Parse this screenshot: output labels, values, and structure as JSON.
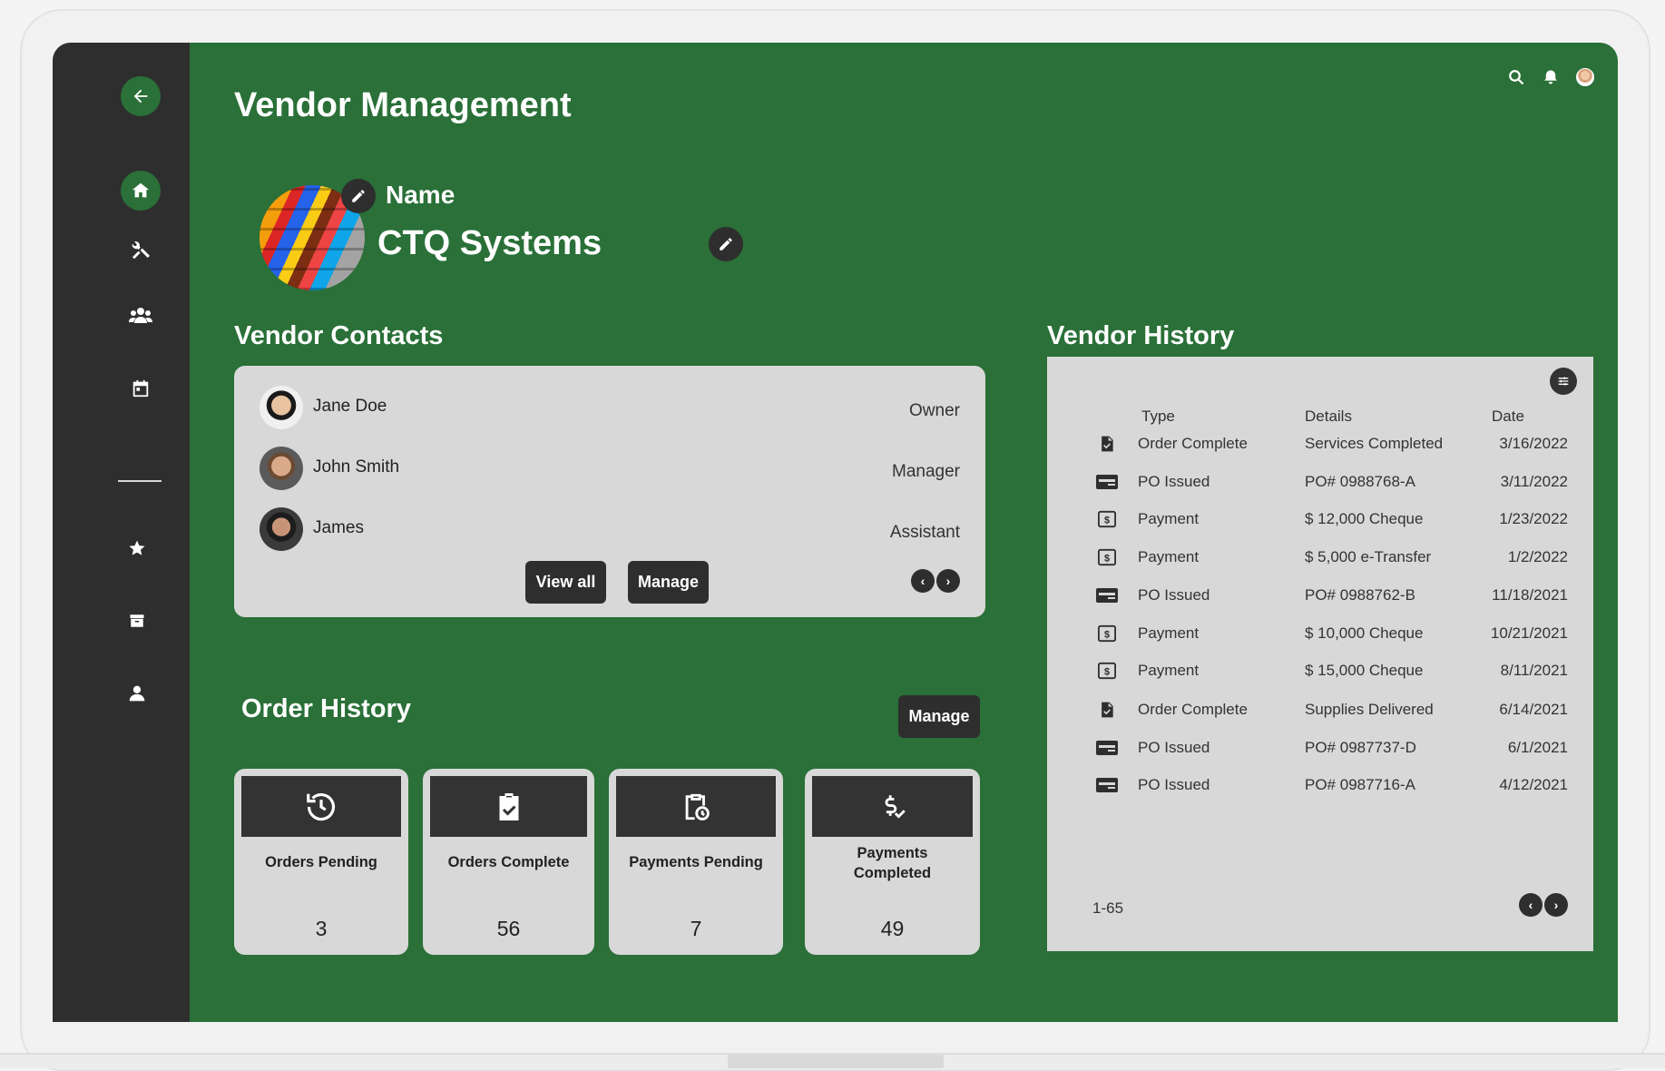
{
  "page": {
    "title": "Vendor Management"
  },
  "vendor": {
    "name_label": "Name",
    "name": "CTQ Systems"
  },
  "contacts": {
    "title": "Vendor Contacts",
    "items": [
      {
        "name": "Jane Doe",
        "role": "Owner"
      },
      {
        "name": "John Smith",
        "role": "Manager"
      },
      {
        "name": "James",
        "role": "Assistant"
      }
    ],
    "view_all_label": "View all",
    "manage_label": "Manage"
  },
  "orders": {
    "title": "Order History",
    "manage_label": "Manage",
    "stats": [
      {
        "label": "Orders Pending",
        "value": "3",
        "icon": "history-icon"
      },
      {
        "label": "Orders Complete",
        "value": "56",
        "icon": "clipboard-check-icon"
      },
      {
        "label": "Payments Pending",
        "value": "7",
        "icon": "clipboard-clock-icon"
      },
      {
        "label": "Payments Completed",
        "value": "49",
        "icon": "dollar-check-icon"
      }
    ]
  },
  "history": {
    "title": "Vendor History",
    "columns": {
      "type": "Type",
      "details": "Details",
      "date": "Date"
    },
    "rows": [
      {
        "type": "Order Complete",
        "details": "Services Completed",
        "date": "3/16/2022",
        "icon": "file-check-icon"
      },
      {
        "type": "PO Issued",
        "details": "PO# 0988768-A",
        "date": "3/11/2022",
        "icon": "card-icon"
      },
      {
        "type": "Payment",
        "details": "$ 12,000 Cheque",
        "date": "1/23/2022",
        "icon": "money-icon"
      },
      {
        "type": "Payment",
        "details": "$ 5,000 e-Transfer",
        "date": "1/2/2022",
        "icon": "money-icon"
      },
      {
        "type": "PO Issued",
        "details": "PO# 0988762-B",
        "date": "11/18/2021",
        "icon": "card-icon"
      },
      {
        "type": "Payment",
        "details": "$ 10,000 Cheque",
        "date": "10/21/2021",
        "icon": "money-icon"
      },
      {
        "type": "Payment",
        "details": "$ 15,000 Cheque",
        "date": "8/11/2021",
        "icon": "money-icon"
      },
      {
        "type": "Order Complete",
        "details": "Supplies Delivered",
        "date": "6/14/2021",
        "icon": "file-check-icon"
      },
      {
        "type": "PO Issued",
        "details": "PO# 0987737-D",
        "date": "6/1/2021",
        "icon": "card-icon"
      },
      {
        "type": "PO Issued",
        "details": "PO# 0987716-A",
        "date": "4/12/2021",
        "icon": "card-icon"
      }
    ],
    "range": "1-65"
  },
  "colors": {
    "brand_green": "#2a7038",
    "sidebar": "#2e2e2e",
    "card": "#d8d8d8"
  }
}
